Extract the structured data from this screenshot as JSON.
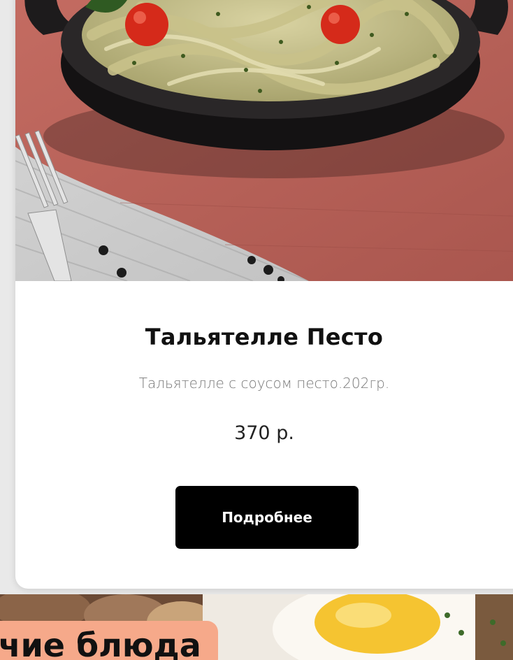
{
  "product": {
    "title": "Тальятелле Песто",
    "description": "Тальятелле с соусом песто.202гр.",
    "price": "370 р.",
    "button_label": "Подробнее"
  },
  "next_section": {
    "label": "чие блюда"
  },
  "colors": {
    "button_bg": "#000000",
    "button_text": "#ffffff",
    "section_label_bg": "#f6a98a",
    "napkin": "#b9645c"
  }
}
